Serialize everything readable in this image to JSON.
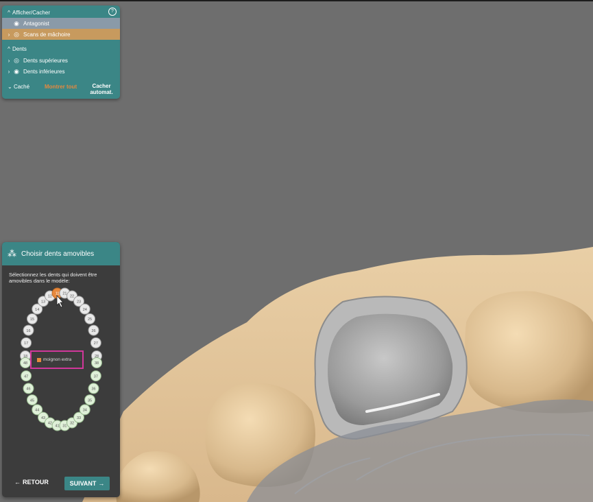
{
  "visibility_panel": {
    "title": "Afficher/Cacher",
    "groups": [
      {
        "items": [
          {
            "label": "Antagonist",
            "icon": "eye-icon",
            "state": "selected-gray"
          },
          {
            "label": "Scans de mâchoire",
            "icon": "eye-outline-icon",
            "state": "selected-orange"
          }
        ]
      }
    ],
    "teeth_section": {
      "title": "Dents",
      "items": [
        {
          "label": "Dents supérieures",
          "icon": "eye-outline-icon"
        },
        {
          "label": "Dents inférieures",
          "icon": "eye-icon"
        }
      ]
    },
    "footer": {
      "hidden_label": "Caché",
      "show_all": "Montrer tout",
      "auto_hide": "Cacher automat."
    },
    "accent_color": "#3b8686",
    "highlight_color": "#e6893e"
  },
  "removable_panel": {
    "title": "Choisir dents amovibles",
    "instruction": "Sélectionnez les dents qui doivent être amovibles dans le modèle:",
    "legend_label": "moignon extra",
    "back_label": "RETOUR",
    "next_label": "SUIVANT",
    "selected_tooth": "11",
    "upper_teeth": [
      "18",
      "17",
      "16",
      "15",
      "14",
      "13",
      "12",
      "11",
      "21",
      "22",
      "23",
      "24",
      "25",
      "26",
      "27",
      "28"
    ],
    "lower_teeth": [
      "48",
      "47",
      "46",
      "45",
      "44",
      "43",
      "42",
      "41",
      "31",
      "32",
      "33",
      "34",
      "35",
      "36",
      "37",
      "38"
    ]
  }
}
